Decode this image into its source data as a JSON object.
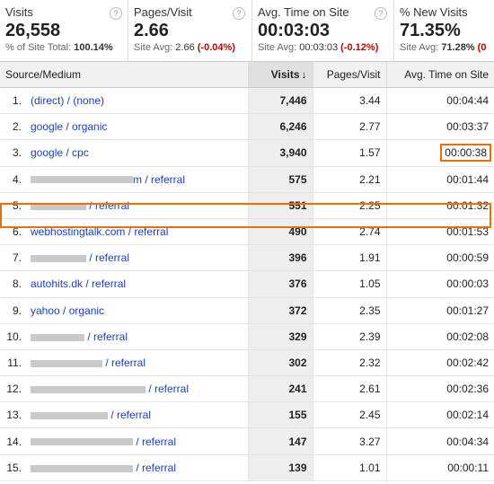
{
  "summary": [
    {
      "title": "Visits",
      "value": "26,558",
      "sub_pre": "% of Site Total: ",
      "sub_val": "100.14%",
      "sub_neg": ""
    },
    {
      "title": "Pages/Visit",
      "value": "2.66",
      "sub_pre": "Site Avg: ",
      "sub_val": "2.66",
      "sub_neg": "(-0.04%)"
    },
    {
      "title": "Avg. Time on Site",
      "value": "00:03:03",
      "sub_pre": "Site Avg: ",
      "sub_val": "00:03:03",
      "sub_neg": "(-0.12%)"
    },
    {
      "title": "% New Visits",
      "value": "71.35%",
      "sub_pre": "Site Avg: ",
      "sub_val": "71.28%",
      "sub_neg": "(0"
    }
  ],
  "help_glyph": "?",
  "table": {
    "headers": {
      "source": "Source/Medium",
      "visits": "Visits",
      "sort_arrow": "↓",
      "pages": "Pages/Visit",
      "time": "Avg. Time on Site"
    },
    "rows": [
      {
        "rank": "1.",
        "src": "(direct) / (none)",
        "blur": 0,
        "visits": "7,446",
        "pages": "3.44",
        "time": "00:04:44"
      },
      {
        "rank": "2.",
        "src": "google / organic",
        "blur": 0,
        "visits": "6,246",
        "pages": "2.77",
        "time": "00:03:37"
      },
      {
        "rank": "3.",
        "src": "google / cpc",
        "blur": 0,
        "visits": "3,940",
        "pages": "1.57",
        "time": "00:00:38"
      },
      {
        "rank": "4.",
        "src": "m / referral",
        "blur": 114,
        "visits": "575",
        "pages": "2.21",
        "time": "00:01:44"
      },
      {
        "rank": "5.",
        "src": " / referral",
        "blur": 62,
        "visits": "551",
        "pages": "2.25",
        "time": "00:01:32"
      },
      {
        "rank": "6.",
        "src": "webhostingtalk.com / referral",
        "blur": 0,
        "visits": "490",
        "pages": "2.74",
        "time": "00:01:53"
      },
      {
        "rank": "7.",
        "src": " / referral",
        "blur": 62,
        "visits": "396",
        "pages": "1.91",
        "time": "00:00:59"
      },
      {
        "rank": "8.",
        "src": "autohits.dk / referral",
        "blur": 0,
        "visits": "376",
        "pages": "1.05",
        "time": "00:00:03"
      },
      {
        "rank": "9.",
        "src": "yahoo / organic",
        "blur": 0,
        "visits": "372",
        "pages": "2.35",
        "time": "00:01:27"
      },
      {
        "rank": "10.",
        "src": " / referral",
        "blur": 60,
        "visits": "329",
        "pages": "2.39",
        "time": "00:02:08"
      },
      {
        "rank": "11.",
        "src": " / referral",
        "blur": 80,
        "visits": "302",
        "pages": "2.32",
        "time": "00:02:42"
      },
      {
        "rank": "12.",
        "src": " / referral",
        "blur": 128,
        "visits": "241",
        "pages": "2.61",
        "time": "00:02:36"
      },
      {
        "rank": "13.",
        "src": " / referral",
        "blur": 86,
        "visits": "155",
        "pages": "2.45",
        "time": "00:02:14"
      },
      {
        "rank": "14.",
        "src": " / referral",
        "blur": 114,
        "visits": "147",
        "pages": "3.27",
        "time": "00:04:34"
      },
      {
        "rank": "15.",
        "src": " / referral",
        "blur": 114,
        "visits": "139",
        "pages": "1.01",
        "time": "00:00:11"
      }
    ]
  }
}
